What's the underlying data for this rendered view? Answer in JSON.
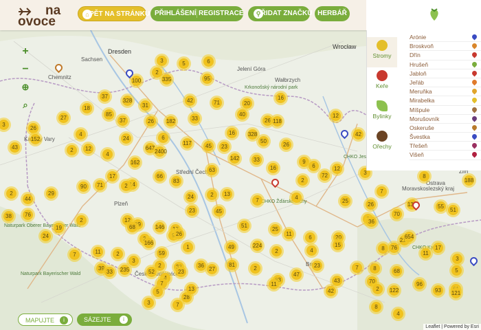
{
  "header": {
    "logo_na": "na",
    "logo_ovoce": "ovoce",
    "back_label": "ZPĚT NA STRÁNKU",
    "login_label": "PŘIHLÁŠENÍ",
    "register_label": "REGISTRACE",
    "add_label": "PŘIDAT ZNAČKU",
    "herbar_label": "HERBÁŘ"
  },
  "panel": {
    "categories": [
      "Stromy",
      "Keře",
      "Bylinky",
      "Ořechy"
    ],
    "plants": [
      {
        "label": "Arónie",
        "color": "#3a4bc2"
      },
      {
        "label": "Broskvoň",
        "color": "#d9862b"
      },
      {
        "label": "Dřín",
        "color": "#c8392f"
      },
      {
        "label": "Hrušeň",
        "color": "#7aad3c"
      },
      {
        "label": "Jabloň",
        "color": "#c8392f"
      },
      {
        "label": "Jeřáb",
        "color": "#e07a2b"
      },
      {
        "label": "Meruňka",
        "color": "#e0a42b"
      },
      {
        "label": "Mirabelka",
        "color": "#e4bf2a"
      },
      {
        "label": "Míšpule",
        "color": "#a07040"
      },
      {
        "label": "Morušovník",
        "color": "#6a3a7a"
      },
      {
        "label": "Oskeruše",
        "color": "#b87a2b"
      },
      {
        "label": "Švestka",
        "color": "#3a4bc2"
      },
      {
        "label": "Třešeň",
        "color": "#9a2f60"
      },
      {
        "label": "Višeň",
        "color": "#b02040"
      }
    ]
  },
  "map_places": [
    {
      "name": "Dresden",
      "big": true
    },
    {
      "name": "Wrocław",
      "big": true
    },
    {
      "name": "Chemnitz"
    },
    {
      "name": "Sachsen"
    },
    {
      "name": "Jelení Góra"
    },
    {
      "name": "Wałbrzych"
    },
    {
      "name": "Krkonošský národní park",
      "green": true
    },
    {
      "name": "Karlovy Vary"
    },
    {
      "name": "Plzeň"
    },
    {
      "name": "Střední Čechy"
    },
    {
      "name": "CHKO Žďárské vrchy",
      "green": true
    },
    {
      "name": "CHKO Jeseníky",
      "green": true
    },
    {
      "name": "Ostrava"
    },
    {
      "name": "Moravskoslezský kraj"
    },
    {
      "name": "Naturpark Bayerischer Wald",
      "green": true
    },
    {
      "name": "Naturpark Oberer Bayerischer Wald",
      "green": true
    },
    {
      "name": "České Budějovice"
    },
    {
      "name": "Brno"
    },
    {
      "name": "CHKO Kysuce",
      "green": true
    },
    {
      "name": "Zlín"
    }
  ],
  "clusters": [
    "3",
    "5",
    "6",
    "100",
    "335",
    "95",
    "2",
    "37",
    "328",
    "31",
    "42",
    "71",
    "20",
    "16",
    "18",
    "85",
    "37",
    "26",
    "182",
    "33",
    "40",
    "26",
    "118",
    "12",
    "3",
    "27",
    "4",
    "24",
    "6",
    "26",
    "152",
    "647",
    "2400",
    "117",
    "45",
    "16",
    "328",
    "50",
    "26",
    "43",
    "2",
    "12",
    "4",
    "162",
    "66",
    "23",
    "142",
    "33",
    "16",
    "9",
    "6",
    "42",
    "12",
    "90",
    "71",
    "14",
    "83",
    "63",
    "2",
    "72",
    "3",
    "8",
    "2",
    "44",
    "29",
    "17",
    "2",
    "24",
    "2",
    "13",
    "4",
    "7",
    "137",
    "55",
    "188",
    "25",
    "26",
    "38",
    "76",
    "2",
    "12",
    "29",
    "23",
    "45",
    "7",
    "70",
    "51",
    "3",
    "24",
    "19",
    "68",
    "146",
    "17",
    "9",
    "26",
    "51",
    "25",
    "11",
    "6",
    "20",
    "2",
    "1",
    "166",
    "59",
    "15",
    "36",
    "214",
    "654",
    "49",
    "224",
    "2",
    "4",
    "8",
    "76",
    "11",
    "17",
    "3",
    "5",
    "7",
    "11",
    "2",
    "3",
    "235",
    "39",
    "2",
    "33",
    "23",
    "36",
    "83",
    "47",
    "43",
    "70",
    "2",
    "61",
    "33",
    "52",
    "4",
    "27",
    "81",
    "23",
    "7",
    "8",
    "68",
    "96",
    "11",
    "2",
    "3",
    "7",
    "28",
    "7",
    "13",
    "42",
    "5",
    "122",
    "93",
    "121",
    "8",
    "4"
  ],
  "bottom": {
    "mapujte_label": "MAPUJTE",
    "sazejte_label": "SÁZEJTE",
    "attribution": "Leaflet | Powered by Esri"
  }
}
